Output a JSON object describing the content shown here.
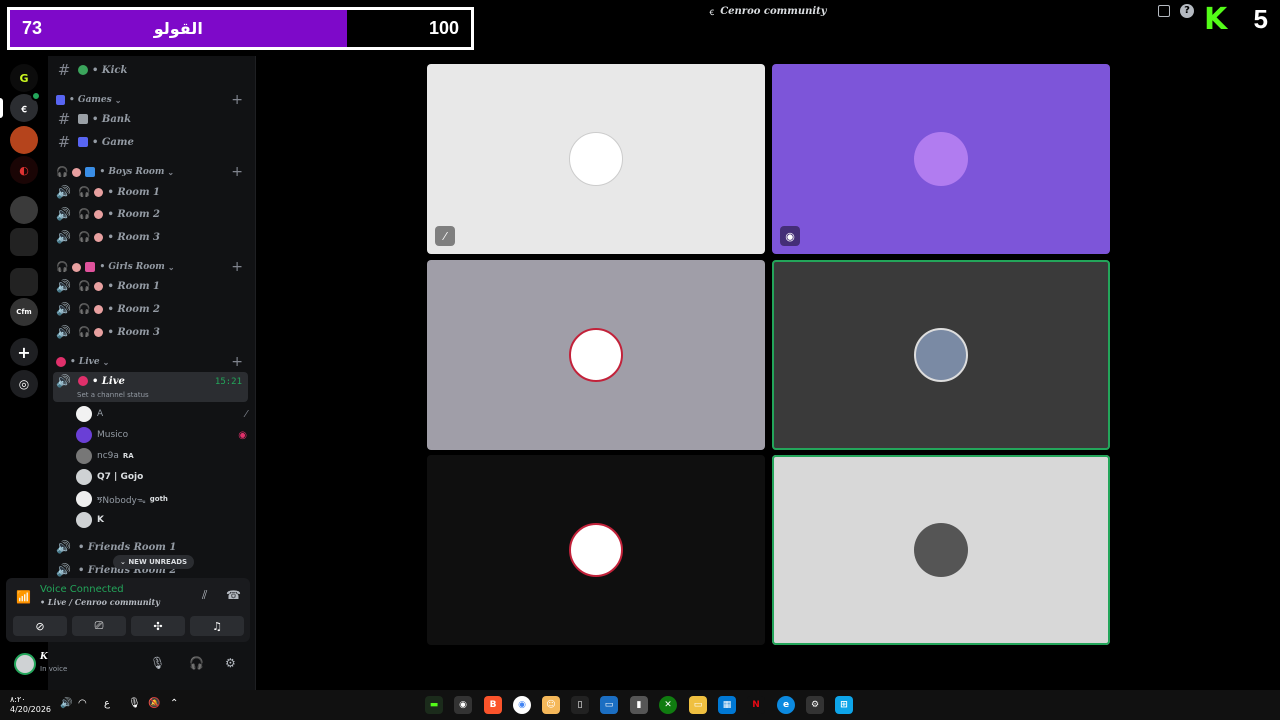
{
  "overlay": {
    "left_score": "73",
    "name": "القولو",
    "right_score": "100",
    "fill_fraction": 0.73,
    "fill_color": "#7e09c9"
  },
  "titlebar": {
    "title": "Cenroo community",
    "kick_count": "5",
    "kick_color": "#53fc18"
  },
  "channels": {
    "kick": "• Kick",
    "games_category": "• Games",
    "bank": "• Bank",
    "game": "• Game",
    "boys_category": "• Boys Room",
    "boys_rooms": [
      "• Room 1",
      "• Room 2",
      "• Room 3"
    ],
    "girls_category": "• Girls Room",
    "girls_rooms": [
      "• Room 1",
      "• Room 2",
      "• Room 3"
    ],
    "live_category": "• Live",
    "live_channel": "• Live",
    "live_time": "15:21",
    "live_status": "Set a channel status",
    "friends_room_1": "• Friends Room 1",
    "friends_room_2": "• Friends Room 2",
    "new_unreads": "NEW UNREADS"
  },
  "members": [
    {
      "name": "A",
      "right_icon": "muted-icon"
    },
    {
      "name": "Musico",
      "right_icon": "streaming-icon"
    },
    {
      "name": "nc9a",
      "tag": "RA"
    },
    {
      "name": "Q7 | Gojo"
    },
    {
      "name": "ኝNobodyᯓ",
      "tag": "goth"
    },
    {
      "name": "K"
    }
  ],
  "voice": {
    "title": "Voice Connected",
    "location": "• Live / Cenroo community"
  },
  "user": {
    "name": "K",
    "status": "In voice"
  },
  "taskbar": {
    "time": "۸:۲۰",
    "date": "4/20/2026",
    "lang": "ع"
  },
  "colors": {
    "accent_green": "#23a55a",
    "tile_purple": "#7d55d9",
    "sidebar_bg": "#111214"
  }
}
